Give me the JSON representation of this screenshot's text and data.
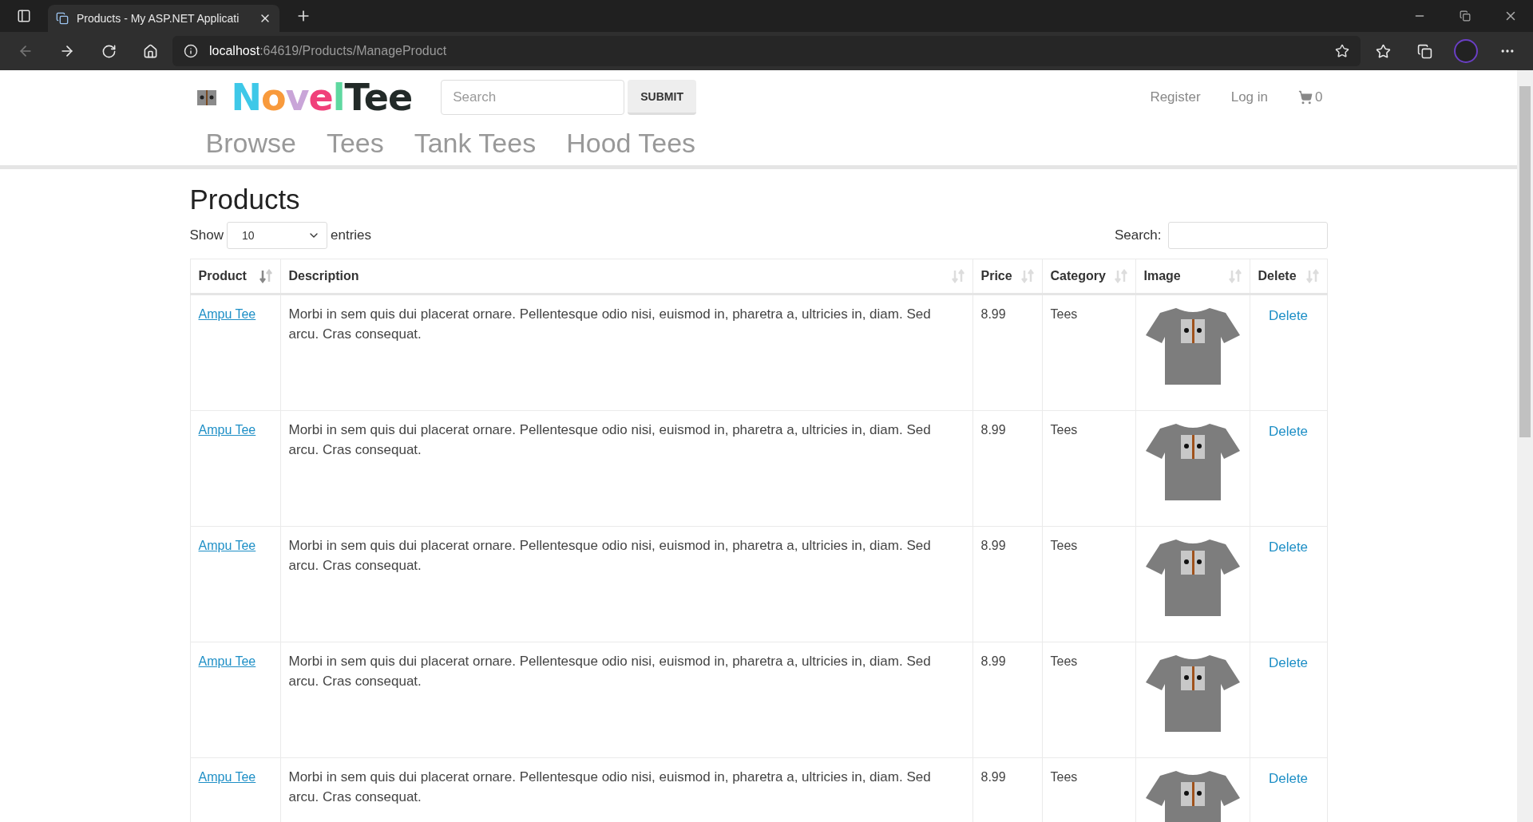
{
  "browser": {
    "tab_title": "Products - My ASP.NET Applicati",
    "address_host": "localhost",
    "address_path": ":64619/Products/ManageProduct"
  },
  "header": {
    "logo": [
      {
        "text": "N",
        "color": "#3ec8e8"
      },
      {
        "text": "o",
        "color": "#f89a3c"
      },
      {
        "text": "v",
        "color": "#c9a5d8"
      },
      {
        "text": "e",
        "color": "#f0407a"
      },
      {
        "text": "l",
        "color": "#5fd8a0"
      },
      {
        "text": "Tee",
        "color": "#222a28"
      }
    ],
    "search": {
      "placeholder": "Search"
    },
    "submit": "SUBMIT",
    "links": [
      "Register",
      "Log in"
    ],
    "cart_count": "0",
    "nav": [
      "Browse",
      "Tees",
      "Tank Tees",
      "Hood Tees"
    ]
  },
  "page": {
    "title": "Products",
    "show_label": "Show",
    "entries_value": "10",
    "entries_label": "entries",
    "search_label": "Search:"
  },
  "table": {
    "columns": [
      {
        "label": "Product",
        "sorted": true
      },
      {
        "label": "Description",
        "sorted": false
      },
      {
        "label": "Price",
        "sorted": false
      },
      {
        "label": "Category",
        "sorted": false
      },
      {
        "label": "Image",
        "sorted": false
      },
      {
        "label": "Delete",
        "sorted": false
      }
    ],
    "rows": [
      {
        "product": "Ampu Tee",
        "description": "Morbi in sem quis dui placerat ornare. Pellentesque odio nisi, euismod in, pharetra a, ultricies in, diam. Sed arcu. Cras consequat.",
        "price": "8.99",
        "category": "Tees",
        "action": "Delete"
      },
      {
        "product": "Ampu Tee",
        "description": "Morbi in sem quis dui placerat ornare. Pellentesque odio nisi, euismod in, pharetra a, ultricies in, diam. Sed arcu. Cras consequat.",
        "price": "8.99",
        "category": "Tees",
        "action": "Delete"
      },
      {
        "product": "Ampu Tee",
        "description": "Morbi in sem quis dui placerat ornare. Pellentesque odio nisi, euismod in, pharetra a, ultricies in, diam. Sed arcu. Cras consequat.",
        "price": "8.99",
        "category": "Tees",
        "action": "Delete"
      },
      {
        "product": "Ampu Tee",
        "description": "Morbi in sem quis dui placerat ornare. Pellentesque odio nisi, euismod in, pharetra a, ultricies in, diam. Sed arcu. Cras consequat.",
        "price": "8.99",
        "category": "Tees",
        "action": "Delete"
      },
      {
        "product": "Ampu Tee",
        "description": "Morbi in sem quis dui placerat ornare. Pellentesque odio nisi, euismod in, pharetra a, ultricies in, diam. Sed arcu. Cras consequat.",
        "price": "8.99",
        "category": "Tees",
        "action": "Delete"
      }
    ]
  }
}
